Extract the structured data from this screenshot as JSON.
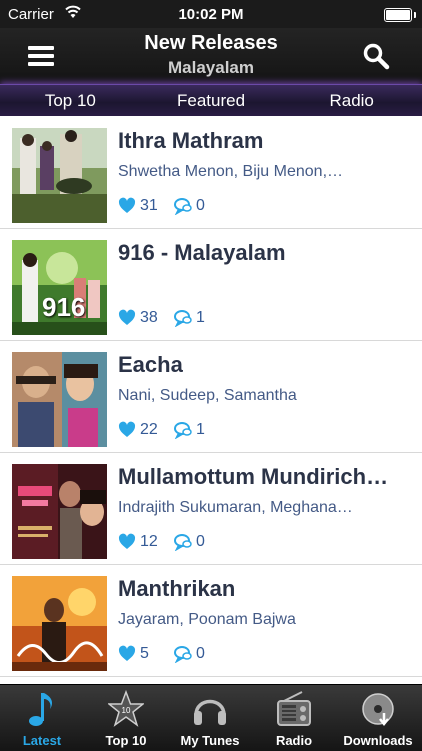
{
  "status": {
    "carrier": "Carrier",
    "time": "10:02 PM"
  },
  "nav": {
    "title": "New Releases",
    "subtitle": "Malayalam"
  },
  "tabs": [
    {
      "label": "Top 10"
    },
    {
      "label": "Featured"
    },
    {
      "label": "Radio"
    }
  ],
  "items": [
    {
      "title": "Ithra Mathram",
      "cast": "Shwetha Menon, Biju Menon,…",
      "likes": "31",
      "comments": "0"
    },
    {
      "title": "916 - Malayalam",
      "cast": "",
      "likes": "38",
      "comments": "1",
      "poster_text": "916"
    },
    {
      "title": "Eacha",
      "cast": "Nani, Sudeep, Samantha",
      "likes": "22",
      "comments": "1"
    },
    {
      "title": "Mullamottum Mundirich…",
      "cast": "Indrajith Sukumaran, Meghana…",
      "likes": "12",
      "comments": "0"
    },
    {
      "title": "Manthrikan",
      "cast": "Jayaram, Poonam Bajwa",
      "likes": "5",
      "comments": "0"
    }
  ],
  "tabbar": [
    {
      "label": "Latest",
      "icon": "music-note-icon",
      "active": true
    },
    {
      "label": "Top 10",
      "icon": "star-icon",
      "badge": "10"
    },
    {
      "label": "My Tunes",
      "icon": "headphones-icon"
    },
    {
      "label": "Radio",
      "icon": "radio-icon"
    },
    {
      "label": "Downloads",
      "icon": "download-disc-icon"
    }
  ],
  "colors": {
    "accent": "#2aa7e6",
    "title": "#2b3347",
    "cast": "#445a86",
    "tabs_glow": "#6c4aa8"
  }
}
